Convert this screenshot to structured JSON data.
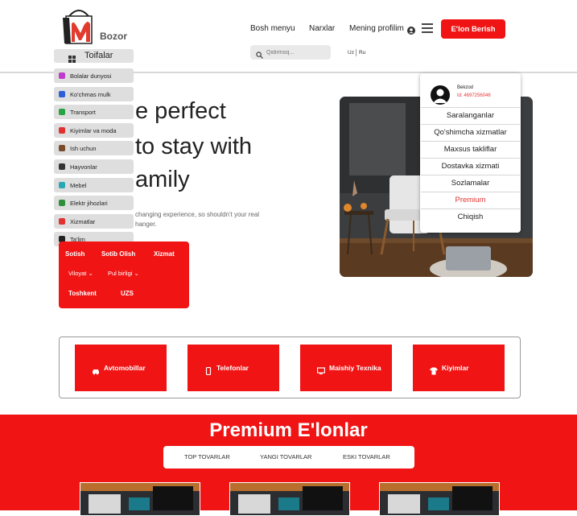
{
  "header": {
    "logo_text": "Bozor",
    "nav": [
      "Bosh menyu",
      "Narxlar",
      "Mening profilim"
    ],
    "post_button": "E'lon Berish",
    "search_placeholder": "Qidirmoq...",
    "lang": [
      "Uz",
      "Ru"
    ]
  },
  "categories": {
    "title": "Toifalar",
    "items": [
      {
        "label": "Bolalar dunyosi",
        "icon": "toy-icon",
        "color": "#c03acb"
      },
      {
        "label": "Ko'chmas mulk",
        "icon": "house-icon",
        "color": "#2f5fd8"
      },
      {
        "label": "Transport",
        "icon": "car-icon",
        "color": "#27a344"
      },
      {
        "label": "Kiyimlar va moda",
        "icon": "shirt-icon",
        "color": "#e23131"
      },
      {
        "label": "Ish uchun",
        "icon": "briefcase-icon",
        "color": "#7a4b2a"
      },
      {
        "label": "Hayvonlar",
        "icon": "paw-icon",
        "color": "#333333"
      },
      {
        "label": "Mebel",
        "icon": "sofa-icon",
        "color": "#2aa7b5"
      },
      {
        "label": "Elektr jihozlari",
        "icon": "phone-icon",
        "color": "#2f8f3a"
      },
      {
        "label": "Xizmatlar",
        "icon": "tools-icon",
        "color": "#e23131"
      },
      {
        "label": "Ta'lim",
        "icon": "graduation-icon",
        "color": "#222222"
      }
    ]
  },
  "hero": {
    "lines": [
      "e perfect",
      "to stay with",
      "amily"
    ],
    "paragraph": [
      "changing experience, so shouldn't your real",
      "hanger."
    ]
  },
  "filter": {
    "tabs": [
      "Sotish",
      "Sotib Olish",
      "Xizmat"
    ],
    "selects": [
      "Viloyat",
      "Pul birligi"
    ],
    "values": [
      "Toshkent",
      "UZS"
    ]
  },
  "profile_menu": {
    "name": "Bekzod",
    "id": "Id: 4697256046",
    "items": [
      "Saralanganlar",
      "Qo'shimcha xizmatlar",
      "Maxsus takliflar",
      "Dostavka xizmati",
      "Sozlamalar",
      "Premium",
      "Chiqish"
    ],
    "highlight_color": "#e23131"
  },
  "category_cards": [
    "Avtomobillar",
    "Telefonlar",
    "Maishiy Texnika",
    "Kiyimlar"
  ],
  "premium": {
    "title": "Premium E'lonlar",
    "tabs": [
      "TOP TOVARLAR",
      "YANGI TOVARLAR",
      "ESKI TOVARLAR"
    ]
  },
  "colors": {
    "accent": "#f01414"
  }
}
